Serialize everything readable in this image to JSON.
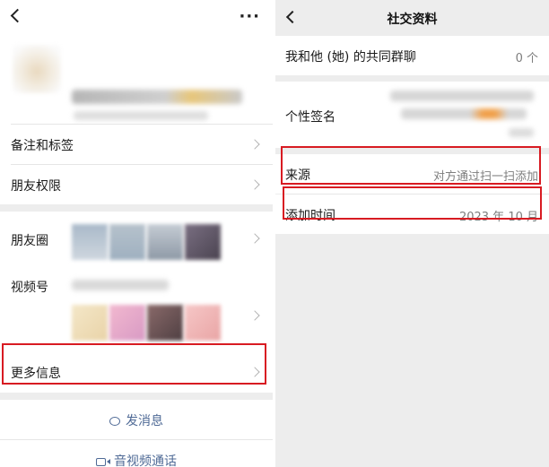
{
  "left": {
    "header": {
      "back_icon": "chevron-left-icon",
      "more_icon": "more-icon",
      "more_label": "···"
    },
    "menu": {
      "remark_tags": "备注和标签",
      "friend_permission": "朋友权限",
      "moments": "朋友圈",
      "channels": "视频号",
      "more_info": "更多信息"
    },
    "actions": {
      "send_message": "发消息",
      "av_call": "音视频通话"
    }
  },
  "right": {
    "header": {
      "title": "社交资料",
      "back_icon": "chevron-left-icon"
    },
    "rows": {
      "common_groups_label": "我和他 (她) 的共同群聊",
      "common_groups_value": "0 个",
      "signature_label": "个性签名",
      "source_label": "来源",
      "source_value": "对方通过扫一扫添加",
      "added_time_label": "添加时间",
      "added_time_value": "2023 年 10 月"
    }
  },
  "colors": {
    "highlight": "#d81b22",
    "link": "#4f6a96",
    "background": "#ededed"
  }
}
